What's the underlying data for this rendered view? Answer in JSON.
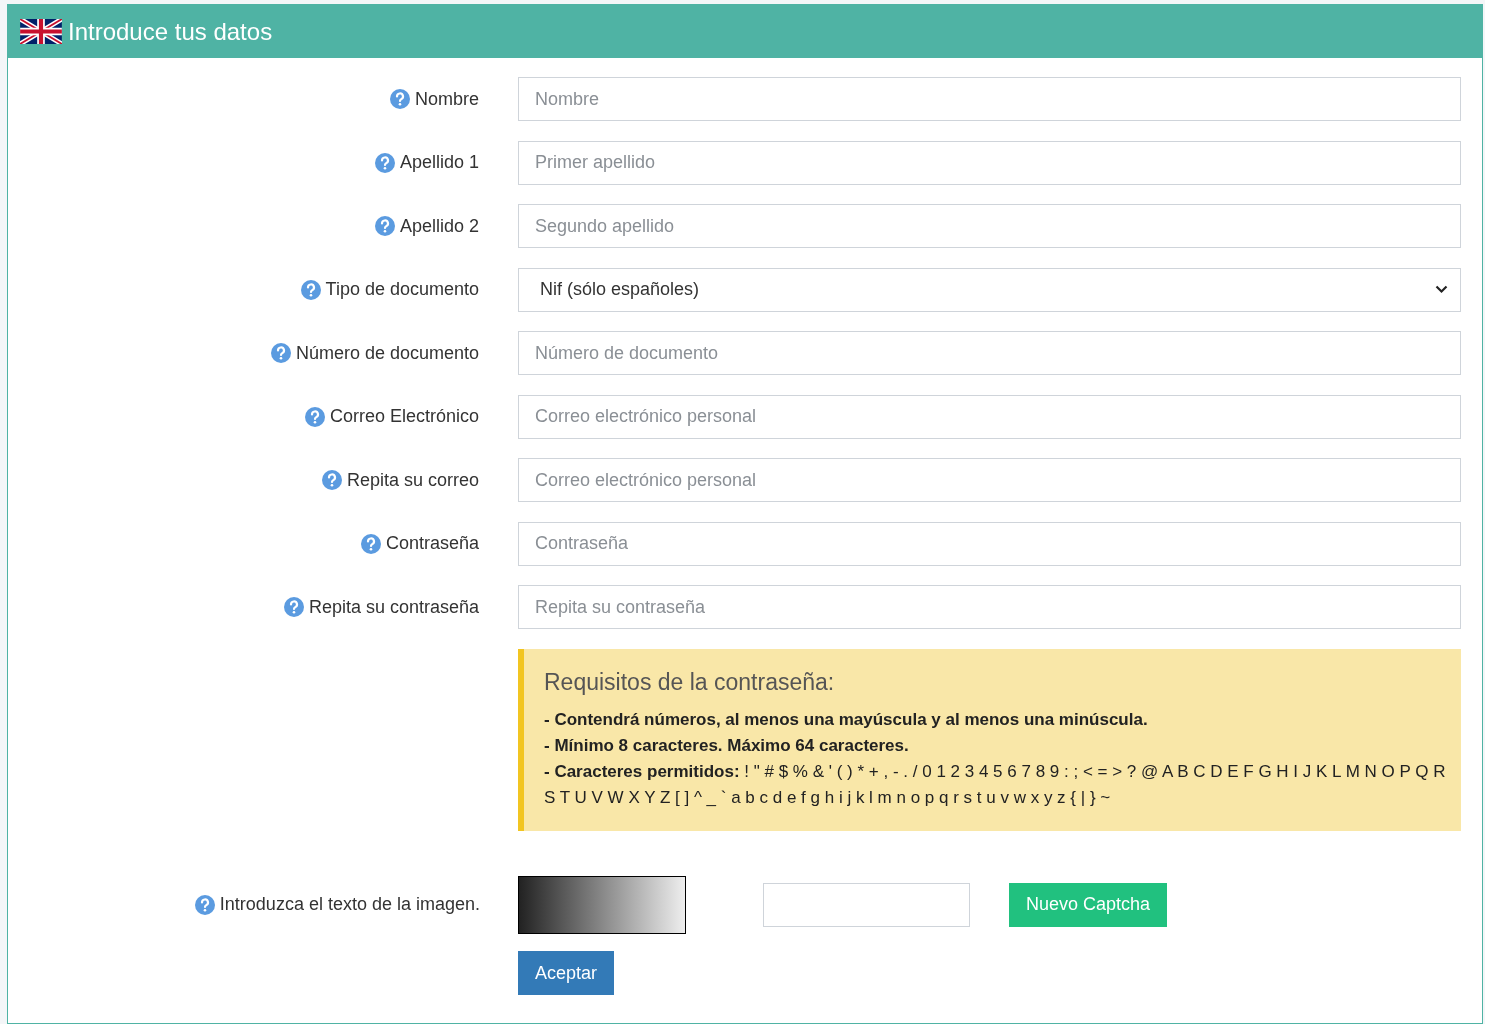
{
  "panel": {
    "title": "Introduce tus datos"
  },
  "fields": [
    {
      "kind": "input",
      "label": "Nombre",
      "placeholder": "Nombre"
    },
    {
      "kind": "input",
      "label": "Apellido 1",
      "placeholder": "Primer apellido"
    },
    {
      "kind": "input",
      "label": "Apellido 2",
      "placeholder": "Segundo apellido"
    },
    {
      "kind": "select",
      "label": "Tipo de documento",
      "value": "Nif (sólo españoles)"
    },
    {
      "kind": "input",
      "label": "Número de documento",
      "placeholder": "Número de documento"
    },
    {
      "kind": "input",
      "label": "Correo Electrónico",
      "placeholder": "Correo electrónico personal"
    },
    {
      "kind": "input",
      "label": "Repita su correo",
      "placeholder": "Correo electrónico personal"
    },
    {
      "kind": "input",
      "label": "Contraseña",
      "placeholder": "Contraseña"
    },
    {
      "kind": "input",
      "label": "Repita su contraseña",
      "placeholder": "Repita su contraseña"
    }
  ],
  "requirements": {
    "title": "Requisitos de la contraseña:",
    "lines": [
      {
        "bold": "- Contendrá números, al menos una mayúscula y al menos una minúscula."
      },
      {
        "bold": "- Mínimo 8 caracteres. Máximo 64 caracteres."
      },
      {
        "bold": "- Caracteres permitidos:",
        "text": "! \" # $ % & ' ( ) * + , - . / 0 1 2 3 4 5 6 7 8 9 : ; < = > ? @ A B C D E F G H I J K L M N O P Q R S T U V W X Y Z [ ] ^ _ ` a b c d e f g h i j k l m n o p q r s t u v w x y z { | } ~"
      }
    ]
  },
  "captcha": {
    "label": "Introduzca el texto de la imagen.",
    "button": "Nuevo Captcha"
  },
  "submit": "Aceptar"
}
